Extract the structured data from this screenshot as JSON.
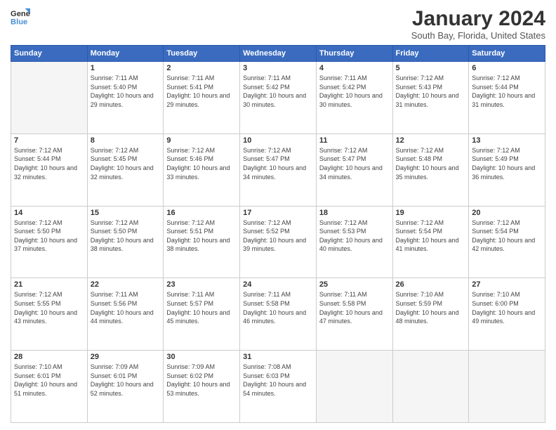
{
  "logo": {
    "line1": "General",
    "line2": "Blue"
  },
  "title": "January 2024",
  "subtitle": "South Bay, Florida, United States",
  "weekdays": [
    "Sunday",
    "Monday",
    "Tuesday",
    "Wednesday",
    "Thursday",
    "Friday",
    "Saturday"
  ],
  "weeks": [
    [
      {
        "day": "",
        "sunrise": "",
        "sunset": "",
        "daylight": ""
      },
      {
        "day": "1",
        "sunrise": "Sunrise: 7:11 AM",
        "sunset": "Sunset: 5:40 PM",
        "daylight": "Daylight: 10 hours and 29 minutes."
      },
      {
        "day": "2",
        "sunrise": "Sunrise: 7:11 AM",
        "sunset": "Sunset: 5:41 PM",
        "daylight": "Daylight: 10 hours and 29 minutes."
      },
      {
        "day": "3",
        "sunrise": "Sunrise: 7:11 AM",
        "sunset": "Sunset: 5:42 PM",
        "daylight": "Daylight: 10 hours and 30 minutes."
      },
      {
        "day": "4",
        "sunrise": "Sunrise: 7:11 AM",
        "sunset": "Sunset: 5:42 PM",
        "daylight": "Daylight: 10 hours and 30 minutes."
      },
      {
        "day": "5",
        "sunrise": "Sunrise: 7:12 AM",
        "sunset": "Sunset: 5:43 PM",
        "daylight": "Daylight: 10 hours and 31 minutes."
      },
      {
        "day": "6",
        "sunrise": "Sunrise: 7:12 AM",
        "sunset": "Sunset: 5:44 PM",
        "daylight": "Daylight: 10 hours and 31 minutes."
      }
    ],
    [
      {
        "day": "7",
        "sunrise": "Sunrise: 7:12 AM",
        "sunset": "Sunset: 5:44 PM",
        "daylight": "Daylight: 10 hours and 32 minutes."
      },
      {
        "day": "8",
        "sunrise": "Sunrise: 7:12 AM",
        "sunset": "Sunset: 5:45 PM",
        "daylight": "Daylight: 10 hours and 32 minutes."
      },
      {
        "day": "9",
        "sunrise": "Sunrise: 7:12 AM",
        "sunset": "Sunset: 5:46 PM",
        "daylight": "Daylight: 10 hours and 33 minutes."
      },
      {
        "day": "10",
        "sunrise": "Sunrise: 7:12 AM",
        "sunset": "Sunset: 5:47 PM",
        "daylight": "Daylight: 10 hours and 34 minutes."
      },
      {
        "day": "11",
        "sunrise": "Sunrise: 7:12 AM",
        "sunset": "Sunset: 5:47 PM",
        "daylight": "Daylight: 10 hours and 34 minutes."
      },
      {
        "day": "12",
        "sunrise": "Sunrise: 7:12 AM",
        "sunset": "Sunset: 5:48 PM",
        "daylight": "Daylight: 10 hours and 35 minutes."
      },
      {
        "day": "13",
        "sunrise": "Sunrise: 7:12 AM",
        "sunset": "Sunset: 5:49 PM",
        "daylight": "Daylight: 10 hours and 36 minutes."
      }
    ],
    [
      {
        "day": "14",
        "sunrise": "Sunrise: 7:12 AM",
        "sunset": "Sunset: 5:50 PM",
        "daylight": "Daylight: 10 hours and 37 minutes."
      },
      {
        "day": "15",
        "sunrise": "Sunrise: 7:12 AM",
        "sunset": "Sunset: 5:50 PM",
        "daylight": "Daylight: 10 hours and 38 minutes."
      },
      {
        "day": "16",
        "sunrise": "Sunrise: 7:12 AM",
        "sunset": "Sunset: 5:51 PM",
        "daylight": "Daylight: 10 hours and 38 minutes."
      },
      {
        "day": "17",
        "sunrise": "Sunrise: 7:12 AM",
        "sunset": "Sunset: 5:52 PM",
        "daylight": "Daylight: 10 hours and 39 minutes."
      },
      {
        "day": "18",
        "sunrise": "Sunrise: 7:12 AM",
        "sunset": "Sunset: 5:53 PM",
        "daylight": "Daylight: 10 hours and 40 minutes."
      },
      {
        "day": "19",
        "sunrise": "Sunrise: 7:12 AM",
        "sunset": "Sunset: 5:54 PM",
        "daylight": "Daylight: 10 hours and 41 minutes."
      },
      {
        "day": "20",
        "sunrise": "Sunrise: 7:12 AM",
        "sunset": "Sunset: 5:54 PM",
        "daylight": "Daylight: 10 hours and 42 minutes."
      }
    ],
    [
      {
        "day": "21",
        "sunrise": "Sunrise: 7:12 AM",
        "sunset": "Sunset: 5:55 PM",
        "daylight": "Daylight: 10 hours and 43 minutes."
      },
      {
        "day": "22",
        "sunrise": "Sunrise: 7:11 AM",
        "sunset": "Sunset: 5:56 PM",
        "daylight": "Daylight: 10 hours and 44 minutes."
      },
      {
        "day": "23",
        "sunrise": "Sunrise: 7:11 AM",
        "sunset": "Sunset: 5:57 PM",
        "daylight": "Daylight: 10 hours and 45 minutes."
      },
      {
        "day": "24",
        "sunrise": "Sunrise: 7:11 AM",
        "sunset": "Sunset: 5:58 PM",
        "daylight": "Daylight: 10 hours and 46 minutes."
      },
      {
        "day": "25",
        "sunrise": "Sunrise: 7:11 AM",
        "sunset": "Sunset: 5:58 PM",
        "daylight": "Daylight: 10 hours and 47 minutes."
      },
      {
        "day": "26",
        "sunrise": "Sunrise: 7:10 AM",
        "sunset": "Sunset: 5:59 PM",
        "daylight": "Daylight: 10 hours and 48 minutes."
      },
      {
        "day": "27",
        "sunrise": "Sunrise: 7:10 AM",
        "sunset": "Sunset: 6:00 PM",
        "daylight": "Daylight: 10 hours and 49 minutes."
      }
    ],
    [
      {
        "day": "28",
        "sunrise": "Sunrise: 7:10 AM",
        "sunset": "Sunset: 6:01 PM",
        "daylight": "Daylight: 10 hours and 51 minutes."
      },
      {
        "day": "29",
        "sunrise": "Sunrise: 7:09 AM",
        "sunset": "Sunset: 6:01 PM",
        "daylight": "Daylight: 10 hours and 52 minutes."
      },
      {
        "day": "30",
        "sunrise": "Sunrise: 7:09 AM",
        "sunset": "Sunset: 6:02 PM",
        "daylight": "Daylight: 10 hours and 53 minutes."
      },
      {
        "day": "31",
        "sunrise": "Sunrise: 7:08 AM",
        "sunset": "Sunset: 6:03 PM",
        "daylight": "Daylight: 10 hours and 54 minutes."
      },
      {
        "day": "",
        "sunrise": "",
        "sunset": "",
        "daylight": ""
      },
      {
        "day": "",
        "sunrise": "",
        "sunset": "",
        "daylight": ""
      },
      {
        "day": "",
        "sunrise": "",
        "sunset": "",
        "daylight": ""
      }
    ]
  ]
}
